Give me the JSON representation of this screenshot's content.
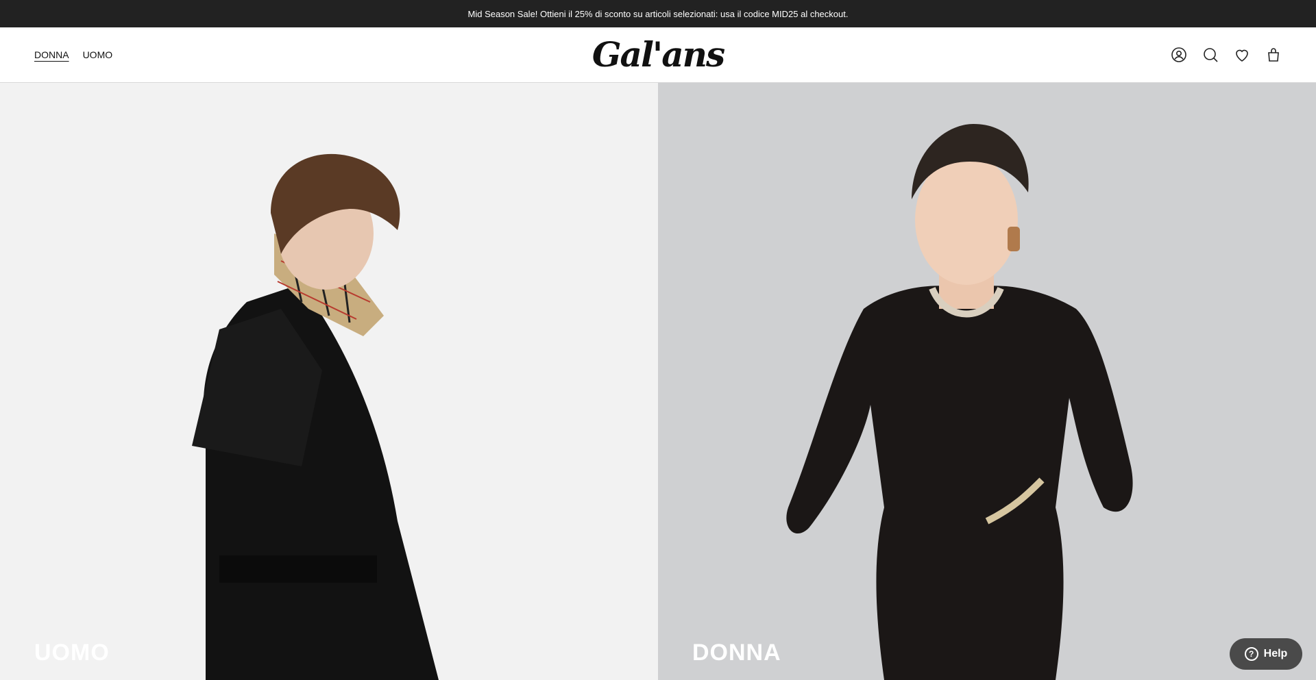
{
  "announcement": "Mid Season Sale! Ottieni il 25% di sconto su articoli selezionati: usa il codice MID25 al checkout.",
  "nav": {
    "donna": "DONNA",
    "uomo": "UOMO"
  },
  "brand": {
    "logo_text": "Gal'ans"
  },
  "header_icons": [
    "account-icon",
    "search-icon",
    "wishlist-heart-icon",
    "cart-bag-icon"
  ],
  "hero": {
    "left_label": "UOMO",
    "right_label": "DONNA"
  },
  "help": {
    "label": "Help"
  },
  "colors": {
    "announcement_bg": "#222222",
    "help_bg": "#4a4a4a"
  }
}
